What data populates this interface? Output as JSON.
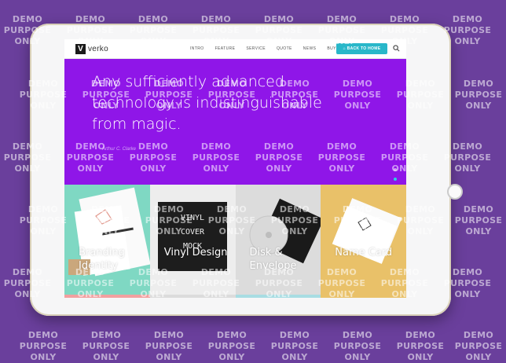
{
  "site": {
    "logo_mark": "V",
    "logo_text": "verko",
    "menu": [
      "INTRO",
      "FEATURE",
      "SERVICE",
      "QUOTE",
      "NEWS",
      "BUY"
    ],
    "back_button": "BACK TO HOME"
  },
  "hero": {
    "quote": "Any sufficiently advanced technology is indistinguishable from magic.",
    "author": "Arthur C. Clarke",
    "slide_count": 4,
    "active_slide": 2,
    "background": "#8f16e8"
  },
  "tiles": [
    {
      "label": "Branding Identity",
      "color": "#7fd8c3"
    },
    {
      "label": "Vinyl Design",
      "color": "#f4f4f4"
    },
    {
      "label": "Disk & Envelope",
      "color": "#e8e8e8"
    },
    {
      "label": "Name Card",
      "color": "#e9c169"
    }
  ],
  "cover_text": [
    "VINYL",
    "COVER",
    "MOCK"
  ],
  "watermark": {
    "line1": "DEMO",
    "line2": "PURPOSE",
    "line3": "ONLY"
  },
  "colors": {
    "background": "#6a3f9c",
    "accent": "#29b7c9"
  }
}
